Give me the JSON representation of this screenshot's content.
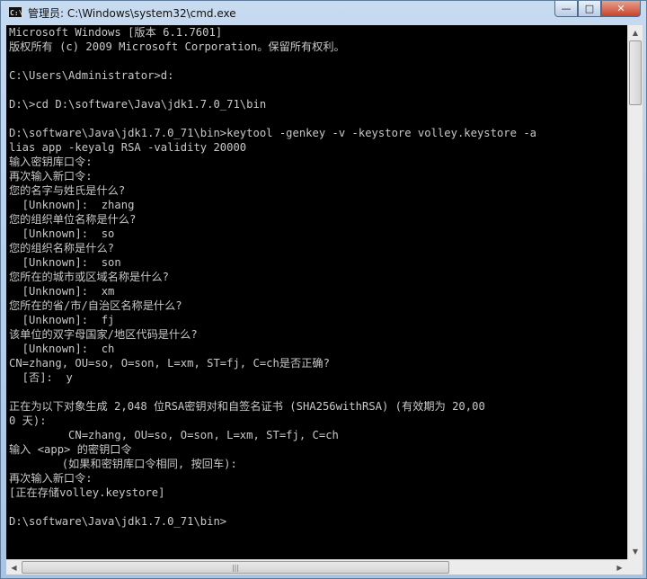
{
  "window": {
    "title": "管理员: C:\\Windows\\system32\\cmd.exe",
    "icon": "C:\\",
    "controls": {
      "minimize": "—",
      "maximize": "□",
      "close": "✕"
    }
  },
  "console": {
    "lines": [
      "Microsoft Windows [版本 6.1.7601]",
      "版权所有 (c) 2009 Microsoft Corporation。保留所有权利。",
      "",
      "C:\\Users\\Administrator>d:",
      "",
      "D:\\>cd D:\\software\\Java\\jdk1.7.0_71\\bin",
      "",
      "D:\\software\\Java\\jdk1.7.0_71\\bin>keytool -genkey -v -keystore volley.keystore -a",
      "lias app -keyalg RSA -validity 20000",
      "输入密钥库口令:",
      "再次输入新口令:",
      "您的名字与姓氏是什么?",
      "  [Unknown]:  zhang",
      "您的组织单位名称是什么?",
      "  [Unknown]:  so",
      "您的组织名称是什么?",
      "  [Unknown]:  son",
      "您所在的城市或区域名称是什么?",
      "  [Unknown]:  xm",
      "您所在的省/市/自治区名称是什么?",
      "  [Unknown]:  fj",
      "该单位的双字母国家/地区代码是什么?",
      "  [Unknown]:  ch",
      "CN=zhang, OU=so, O=son, L=xm, ST=fj, C=ch是否正确?",
      "  [否]:  y",
      "",
      "正在为以下对象生成 2,048 位RSA密钥对和自签名证书 (SHA256withRSA) (有效期为 20,00",
      "0 天):",
      "         CN=zhang, OU=so, O=son, L=xm, ST=fj, C=ch",
      "输入 <app> 的密钥口令",
      "        (如果和密钥库口令相同, 按回车):",
      "再次输入新口令:",
      "[正在存储volley.keystore]",
      "",
      "D:\\software\\Java\\jdk1.7.0_71\\bin>"
    ]
  },
  "colors": {
    "console_bg": "#000000",
    "console_text": "#c8c8c8"
  }
}
